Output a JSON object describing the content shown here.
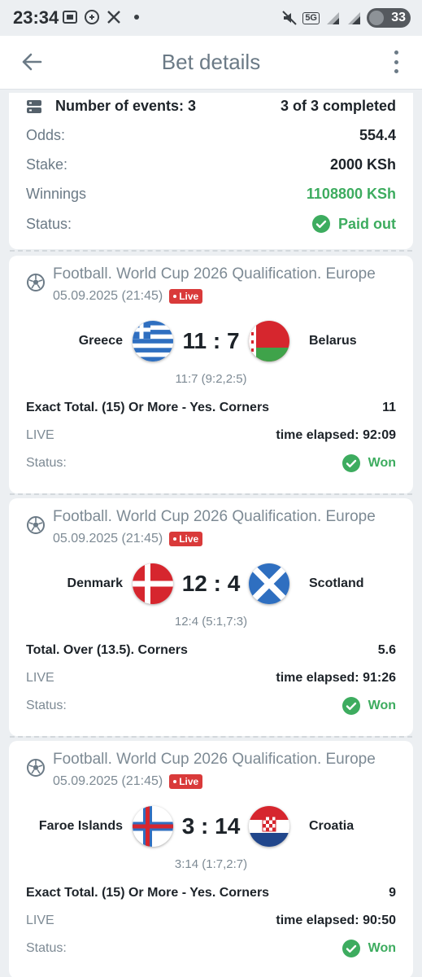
{
  "status_bar": {
    "time": "23:34",
    "network": "5G",
    "battery": "33",
    "icons": [
      "screenshot-icon",
      "whatsapp-icon",
      "x-icon",
      "dot-icon",
      "mute-icon",
      "signal-icon",
      "signal-icon",
      "battery-icon"
    ]
  },
  "header": {
    "title": "Bet details",
    "back_icon": "arrow-left-icon",
    "menu_icon": "more-vertical-icon"
  },
  "summary": {
    "events_label": "Number of events: 3",
    "completed": "3 of 3 completed",
    "odds_label": "Odds:",
    "odds_value": "554.4",
    "stake_label": "Stake:",
    "stake_value": "2000 KSh",
    "winnings_label": "Winnings",
    "winnings_value": "1108800 KSh",
    "status_label": "Status:",
    "status_value": "Paid out"
  },
  "colors": {
    "accent_green": "#3dac5f",
    "live_red": "#d93a3a",
    "muted_text": "#7d8a94"
  },
  "events": [
    {
      "league": "Football. World Cup 2026 Qualification. Europe",
      "datetime": "05.09.2025 (21:45)",
      "live_badge": "Live",
      "home": "Greece",
      "away": "Belarus",
      "score": "11 : 7",
      "subscore": "11:7 (9:2,2:5)",
      "bet": "Exact Total. (15) Or More - Yes. Corners",
      "bet_odds": "11",
      "live_label": "LIVE",
      "elapsed": "time elapsed: 92:09",
      "status_label": "Status:",
      "status_value": "Won"
    },
    {
      "league": "Football. World Cup 2026 Qualification. Europe",
      "datetime": "05.09.2025 (21:45)",
      "live_badge": "Live",
      "home": "Denmark",
      "away": "Scotland",
      "score": "12 : 4",
      "subscore": "12:4 (5:1,7:3)",
      "bet": "Total. Over (13.5). Corners",
      "bet_odds": "5.6",
      "live_label": "LIVE",
      "elapsed": "time elapsed: 91:26",
      "status_label": "Status:",
      "status_value": "Won"
    },
    {
      "league": "Football. World Cup 2026 Qualification. Europe",
      "datetime": "05.09.2025 (21:45)",
      "live_badge": "Live",
      "home": "Faroe Islands",
      "away": "Croatia",
      "score": "3 : 14",
      "subscore": "3:14 (1:7,2:7)",
      "bet": "Exact Total. (15) Or More - Yes. Corners",
      "bet_odds": "9",
      "live_label": "LIVE",
      "elapsed": "time elapsed: 90:50",
      "status_label": "Status:",
      "status_value": "Won"
    }
  ]
}
